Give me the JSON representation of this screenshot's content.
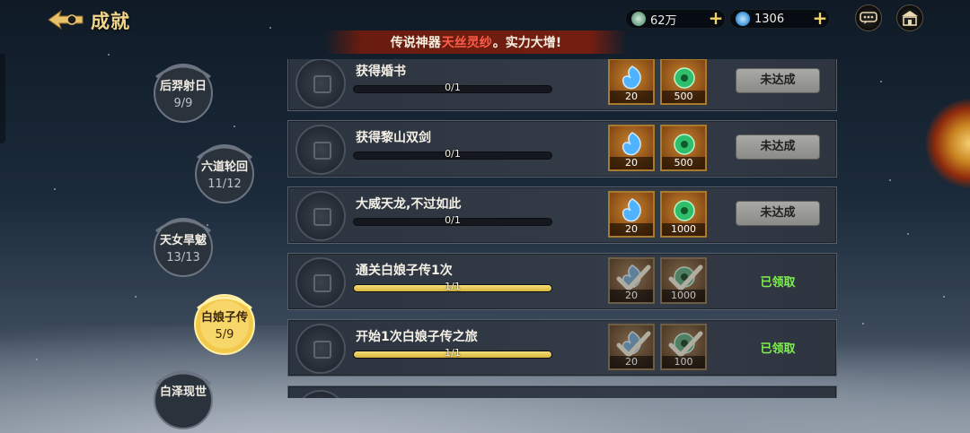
{
  "header": {
    "title": "成就",
    "currency_silver": "62万",
    "currency_jade": "1306"
  },
  "banner": {
    "prefix": "传说神器",
    "highlight": "天丝灵纱",
    "suffix": "。实力大增!"
  },
  "categories": [
    {
      "name": "后羿射日",
      "progress": "9/9",
      "active": false
    },
    {
      "name": "六道轮回",
      "progress": "11/12",
      "active": false
    },
    {
      "name": "天女旱魃",
      "progress": "13/13",
      "active": false
    },
    {
      "name": "白娘子传",
      "progress": "5/9",
      "active": true
    },
    {
      "name": "白泽现世",
      "progress": "",
      "active": false
    }
  ],
  "achievements": [
    {
      "title": "获得婚书",
      "progress_text": "0/1",
      "progress": 0,
      "reward1": "20",
      "reward2": "500",
      "status": "未达成",
      "claimed": false
    },
    {
      "title": "获得黎山双剑",
      "progress_text": "0/1",
      "progress": 0,
      "reward1": "20",
      "reward2": "500",
      "status": "未达成",
      "claimed": false
    },
    {
      "title": "大威天龙,不过如此",
      "progress_text": "0/1",
      "progress": 0,
      "reward1": "20",
      "reward2": "1000",
      "status": "未达成",
      "claimed": false
    },
    {
      "title": "通关白娘子传1次",
      "progress_text": "1/1",
      "progress": 1,
      "reward1": "20",
      "reward2": "1000",
      "status": "已领取",
      "claimed": true
    },
    {
      "title": "开始1次白娘子传之旅",
      "progress_text": "1/1",
      "progress": 1,
      "reward1": "20",
      "reward2": "100",
      "status": "已领取",
      "claimed": true
    }
  ],
  "colors": {
    "gold": "#f1d58a",
    "claimed_green": "#7ff04f",
    "banner_highlight": "#ff5c47",
    "progress_fill": "#e6c552"
  },
  "icons": {
    "back": "back-arrow-icon",
    "silver": "silver-coin-icon",
    "jade": "jade-icon",
    "chat": "chat-icon",
    "shop": "shop-icon",
    "reward1": "blue-spirit-gem-icon",
    "reward2": "green-jade-icon",
    "claimed_mark": "checkmark-icon"
  }
}
